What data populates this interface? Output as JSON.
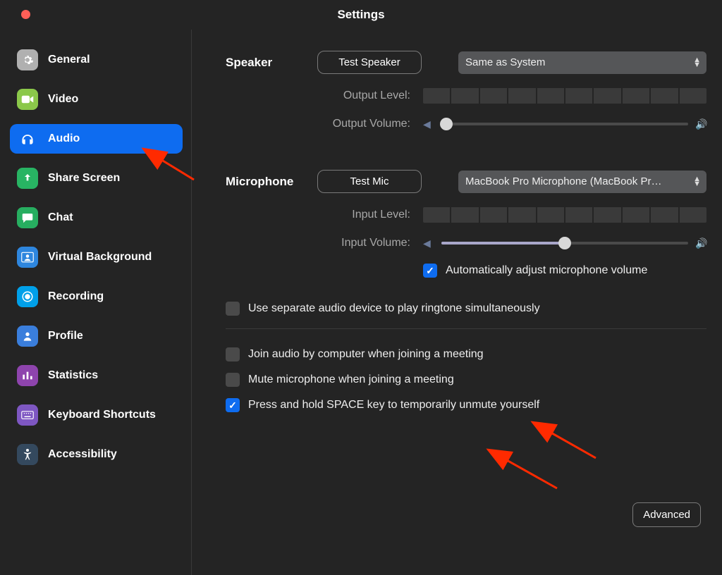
{
  "window": {
    "title": "Settings"
  },
  "sidebar": {
    "items": [
      {
        "label": "General",
        "icon": "gear-icon"
      },
      {
        "label": "Video",
        "icon": "video-icon"
      },
      {
        "label": "Audio",
        "icon": "headphones-icon",
        "active": true
      },
      {
        "label": "Share Screen",
        "icon": "share-icon"
      },
      {
        "label": "Chat",
        "icon": "chat-icon"
      },
      {
        "label": "Virtual Background",
        "icon": "person-bg-icon"
      },
      {
        "label": "Recording",
        "icon": "record-icon"
      },
      {
        "label": "Profile",
        "icon": "profile-icon"
      },
      {
        "label": "Statistics",
        "icon": "stats-icon"
      },
      {
        "label": "Keyboard Shortcuts",
        "icon": "keyboard-icon"
      },
      {
        "label": "Accessibility",
        "icon": "accessibility-icon"
      }
    ]
  },
  "speaker": {
    "heading": "Speaker",
    "test_label": "Test Speaker",
    "device": "Same as System",
    "output_level_label": "Output Level:",
    "output_volume_label": "Output Volume:",
    "output_volume_pct": 2
  },
  "mic": {
    "heading": "Microphone",
    "test_label": "Test Mic",
    "device": "MacBook Pro Microphone (MacBook Pr…",
    "input_level_label": "Input Level:",
    "input_volume_label": "Input Volume:",
    "input_volume_pct": 50,
    "auto_adjust_label": "Automatically adjust microphone volume",
    "auto_adjust_checked": true
  },
  "options": {
    "separate_ringtone_label": "Use separate audio device to play ringtone simultaneously",
    "separate_ringtone_checked": false,
    "join_audio_label": "Join audio by computer when joining a meeting",
    "join_audio_checked": false,
    "mute_on_join_label": "Mute microphone when joining a meeting",
    "mute_on_join_checked": false,
    "space_unmute_label": "Press and hold SPACE key to temporarily unmute yourself",
    "space_unmute_checked": true
  },
  "advanced_label": "Advanced"
}
